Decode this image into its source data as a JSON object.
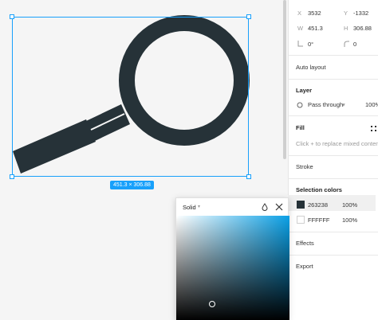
{
  "canvas": {
    "selection_size": "451.3 × 306.88",
    "colors": {
      "selection": "#18a0fb",
      "object": "#263238"
    }
  },
  "panel": {
    "x_label": "X",
    "x_value": "3532",
    "y_label": "Y",
    "y_value": "-1332",
    "w_label": "W",
    "w_value": "451.3",
    "h_label": "H",
    "h_value": "306.88",
    "rotation": "0°",
    "corner_radius": "0",
    "auto_layout": "Auto layout",
    "layer_title": "Layer",
    "blend_mode": "Pass through",
    "opacity": "100%",
    "fill_title": "Fill",
    "fill_hint": "Click + to replace mixed content.",
    "stroke_title": "Stroke",
    "selection_colors_title": "Selection colors",
    "selection_colors": [
      {
        "hex": "263238",
        "opacity": "100%",
        "swatch": "#263238"
      },
      {
        "hex": "FFFFFF",
        "opacity": "100%",
        "swatch": "#ffffff"
      }
    ],
    "effects_title": "Effects",
    "export_title": "Export"
  },
  "picker": {
    "type": "Solid",
    "hue": "#0aa0e6"
  }
}
